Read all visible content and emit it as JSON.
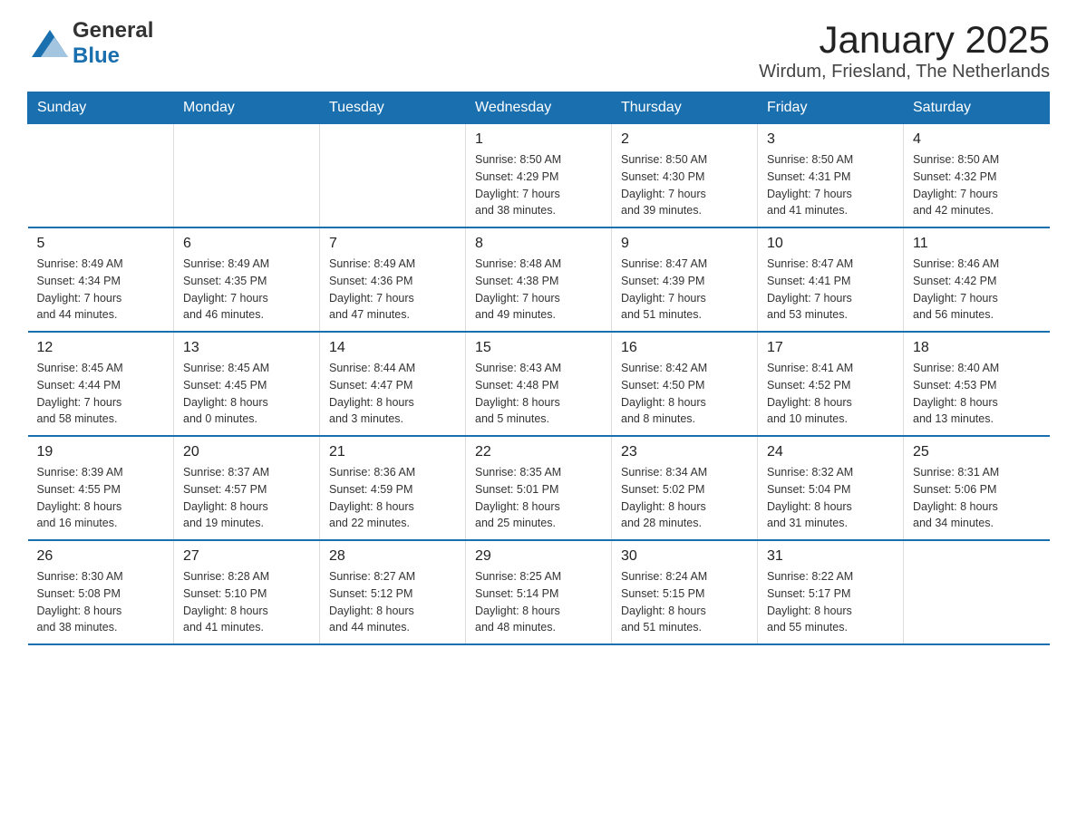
{
  "header": {
    "logo_general": "General",
    "logo_blue": "Blue",
    "title": "January 2025",
    "subtitle": "Wirdum, Friesland, The Netherlands"
  },
  "calendar": {
    "days_of_week": [
      "Sunday",
      "Monday",
      "Tuesday",
      "Wednesday",
      "Thursday",
      "Friday",
      "Saturday"
    ],
    "weeks": [
      [
        {
          "day": "",
          "info": ""
        },
        {
          "day": "",
          "info": ""
        },
        {
          "day": "",
          "info": ""
        },
        {
          "day": "1",
          "info": "Sunrise: 8:50 AM\nSunset: 4:29 PM\nDaylight: 7 hours\nand 38 minutes."
        },
        {
          "day": "2",
          "info": "Sunrise: 8:50 AM\nSunset: 4:30 PM\nDaylight: 7 hours\nand 39 minutes."
        },
        {
          "day": "3",
          "info": "Sunrise: 8:50 AM\nSunset: 4:31 PM\nDaylight: 7 hours\nand 41 minutes."
        },
        {
          "day": "4",
          "info": "Sunrise: 8:50 AM\nSunset: 4:32 PM\nDaylight: 7 hours\nand 42 minutes."
        }
      ],
      [
        {
          "day": "5",
          "info": "Sunrise: 8:49 AM\nSunset: 4:34 PM\nDaylight: 7 hours\nand 44 minutes."
        },
        {
          "day": "6",
          "info": "Sunrise: 8:49 AM\nSunset: 4:35 PM\nDaylight: 7 hours\nand 46 minutes."
        },
        {
          "day": "7",
          "info": "Sunrise: 8:49 AM\nSunset: 4:36 PM\nDaylight: 7 hours\nand 47 minutes."
        },
        {
          "day": "8",
          "info": "Sunrise: 8:48 AM\nSunset: 4:38 PM\nDaylight: 7 hours\nand 49 minutes."
        },
        {
          "day": "9",
          "info": "Sunrise: 8:47 AM\nSunset: 4:39 PM\nDaylight: 7 hours\nand 51 minutes."
        },
        {
          "day": "10",
          "info": "Sunrise: 8:47 AM\nSunset: 4:41 PM\nDaylight: 7 hours\nand 53 minutes."
        },
        {
          "day": "11",
          "info": "Sunrise: 8:46 AM\nSunset: 4:42 PM\nDaylight: 7 hours\nand 56 minutes."
        }
      ],
      [
        {
          "day": "12",
          "info": "Sunrise: 8:45 AM\nSunset: 4:44 PM\nDaylight: 7 hours\nand 58 minutes."
        },
        {
          "day": "13",
          "info": "Sunrise: 8:45 AM\nSunset: 4:45 PM\nDaylight: 8 hours\nand 0 minutes."
        },
        {
          "day": "14",
          "info": "Sunrise: 8:44 AM\nSunset: 4:47 PM\nDaylight: 8 hours\nand 3 minutes."
        },
        {
          "day": "15",
          "info": "Sunrise: 8:43 AM\nSunset: 4:48 PM\nDaylight: 8 hours\nand 5 minutes."
        },
        {
          "day": "16",
          "info": "Sunrise: 8:42 AM\nSunset: 4:50 PM\nDaylight: 8 hours\nand 8 minutes."
        },
        {
          "day": "17",
          "info": "Sunrise: 8:41 AM\nSunset: 4:52 PM\nDaylight: 8 hours\nand 10 minutes."
        },
        {
          "day": "18",
          "info": "Sunrise: 8:40 AM\nSunset: 4:53 PM\nDaylight: 8 hours\nand 13 minutes."
        }
      ],
      [
        {
          "day": "19",
          "info": "Sunrise: 8:39 AM\nSunset: 4:55 PM\nDaylight: 8 hours\nand 16 minutes."
        },
        {
          "day": "20",
          "info": "Sunrise: 8:37 AM\nSunset: 4:57 PM\nDaylight: 8 hours\nand 19 minutes."
        },
        {
          "day": "21",
          "info": "Sunrise: 8:36 AM\nSunset: 4:59 PM\nDaylight: 8 hours\nand 22 minutes."
        },
        {
          "day": "22",
          "info": "Sunrise: 8:35 AM\nSunset: 5:01 PM\nDaylight: 8 hours\nand 25 minutes."
        },
        {
          "day": "23",
          "info": "Sunrise: 8:34 AM\nSunset: 5:02 PM\nDaylight: 8 hours\nand 28 minutes."
        },
        {
          "day": "24",
          "info": "Sunrise: 8:32 AM\nSunset: 5:04 PM\nDaylight: 8 hours\nand 31 minutes."
        },
        {
          "day": "25",
          "info": "Sunrise: 8:31 AM\nSunset: 5:06 PM\nDaylight: 8 hours\nand 34 minutes."
        }
      ],
      [
        {
          "day": "26",
          "info": "Sunrise: 8:30 AM\nSunset: 5:08 PM\nDaylight: 8 hours\nand 38 minutes."
        },
        {
          "day": "27",
          "info": "Sunrise: 8:28 AM\nSunset: 5:10 PM\nDaylight: 8 hours\nand 41 minutes."
        },
        {
          "day": "28",
          "info": "Sunrise: 8:27 AM\nSunset: 5:12 PM\nDaylight: 8 hours\nand 44 minutes."
        },
        {
          "day": "29",
          "info": "Sunrise: 8:25 AM\nSunset: 5:14 PM\nDaylight: 8 hours\nand 48 minutes."
        },
        {
          "day": "30",
          "info": "Sunrise: 8:24 AM\nSunset: 5:15 PM\nDaylight: 8 hours\nand 51 minutes."
        },
        {
          "day": "31",
          "info": "Sunrise: 8:22 AM\nSunset: 5:17 PM\nDaylight: 8 hours\nand 55 minutes."
        },
        {
          "day": "",
          "info": ""
        }
      ]
    ]
  }
}
